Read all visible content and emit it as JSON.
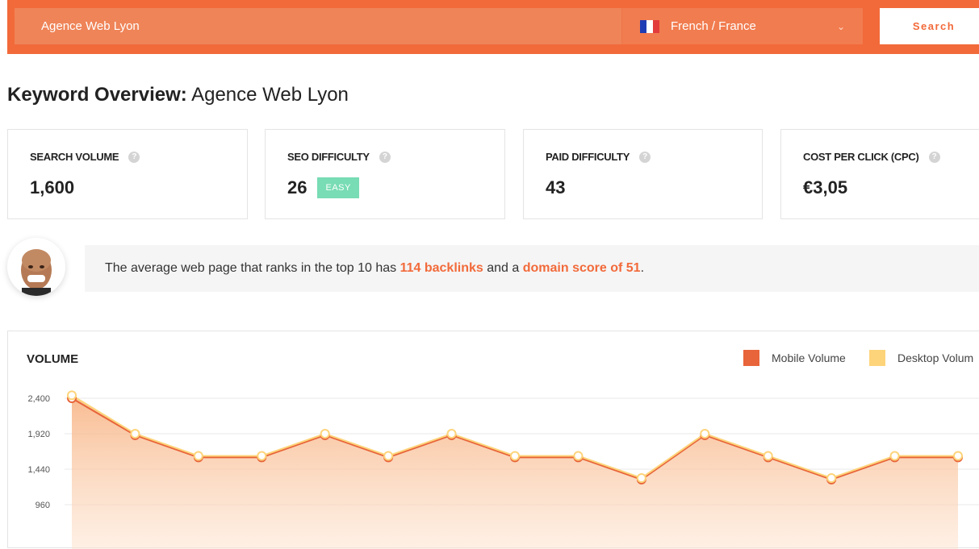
{
  "search": {
    "keyword": "Agence Web Lyon",
    "language": "French / France",
    "button_label": "Search"
  },
  "colors": {
    "brand": "#f26a3a",
    "mobile": "#e8643a",
    "desktop": "#fdd47a",
    "easy": "#78dcb4",
    "flag_blue": "#1e3cb4",
    "flag_red": "#e23c3c"
  },
  "title": {
    "prefix": "Keyword Overview:",
    "keyword": "Agence Web Lyon"
  },
  "metrics": [
    {
      "label": "SEARCH VOLUME",
      "value": "1,600"
    },
    {
      "label": "SEO DIFFICULTY",
      "value": "26",
      "badge": "EASY"
    },
    {
      "label": "PAID DIFFICULTY",
      "value": "43"
    },
    {
      "label": "COST PER CLICK (CPC)",
      "value": "€3,05"
    }
  ],
  "help_icon": "?",
  "insight": {
    "text_1": "The average web page that ranks in the top 10 has",
    "backlinks": "114 backlinks",
    "text_2": "and a",
    "domain_score": "domain score of 51",
    "text_3": "."
  },
  "volume": {
    "title": "VOLUME",
    "legend": {
      "mobile": "Mobile Volume",
      "desktop": "Desktop Volum"
    }
  },
  "chart_data": {
    "type": "area",
    "title": "VOLUME",
    "y_ticks": [
      "2,400",
      "1,920",
      "1,440",
      "960"
    ],
    "ylim": [
      960,
      2400
    ],
    "grid": true,
    "legend_position": "top-right",
    "x": [
      1,
      2,
      3,
      4,
      5,
      6,
      7,
      8,
      9,
      10,
      11,
      12,
      13,
      14,
      15
    ],
    "series": [
      {
        "name": "Mobile Volume",
        "values": [
          2400,
          1900,
          1600,
          1600,
          1900,
          1600,
          1900,
          1600,
          1600,
          1300,
          1900,
          1600,
          1300,
          1600,
          1600
        ]
      },
      {
        "name": "Desktop Volum",
        "values": [
          2440,
          1920,
          1620,
          1620,
          1920,
          1620,
          1920,
          1620,
          1620,
          1320,
          1920,
          1620,
          1320,
          1620,
          1620
        ]
      }
    ]
  }
}
